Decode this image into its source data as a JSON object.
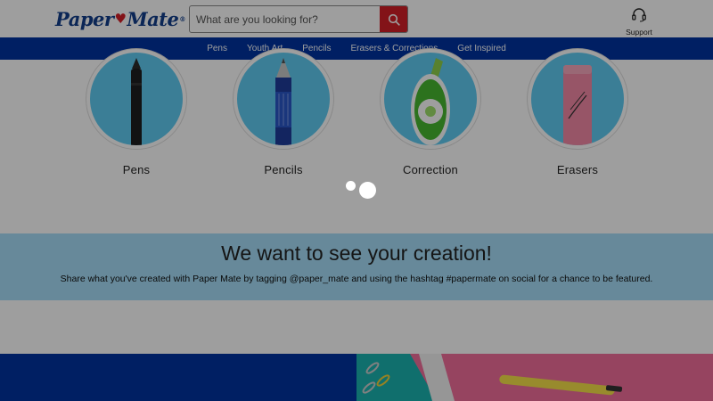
{
  "header": {
    "logo_left": "Paper",
    "logo_heart": "♥",
    "logo_right": "Mate",
    "logo_reg": "®",
    "search_placeholder": "What are you looking for?",
    "search_icon": "search-icon",
    "support_label": "Support",
    "support_icon": "headset-icon"
  },
  "nav": {
    "items": [
      "Pens",
      "Youth Art",
      "Pencils",
      "Erasers & Corrections",
      "Get Inspired"
    ]
  },
  "categories": [
    {
      "label": "Pens",
      "icon": "pen-image"
    },
    {
      "label": "Pencils",
      "icon": "pencil-image"
    },
    {
      "label": "Correction",
      "icon": "correction-tape-image"
    },
    {
      "label": "Erasers",
      "icon": "eraser-image"
    }
  ],
  "banner": {
    "title": "We want to see your creation!",
    "text": "Share what you've created with Paper Mate by tagging @paper_mate and using the hashtag #papermate on social for a chance to be featured."
  },
  "colors": {
    "brand_blue": "#0033a0",
    "brand_red": "#d32027",
    "circle_blue": "#60cbf3",
    "banner_blue": "#a6def8",
    "pink": "#f26e9c"
  },
  "overlay": {
    "state": "loading",
    "spinner_icon": "loading-spinner-icon"
  }
}
